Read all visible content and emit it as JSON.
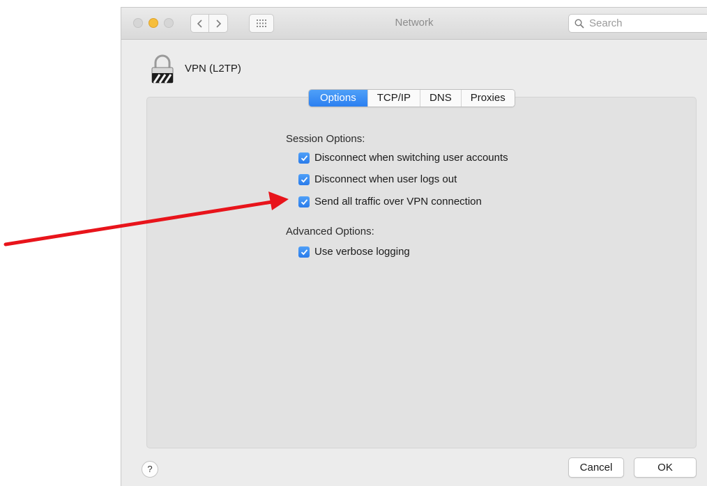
{
  "window": {
    "title": "Network",
    "search_placeholder": "Search"
  },
  "connection": {
    "name": "VPN (L2TP)",
    "icon": "vpn-lock-icon"
  },
  "tabs": [
    {
      "label": "Options",
      "active": true
    },
    {
      "label": "TCP/IP",
      "active": false
    },
    {
      "label": "DNS",
      "active": false
    },
    {
      "label": "Proxies",
      "active": false
    }
  ],
  "session_options": {
    "heading": "Session Options:",
    "items": [
      {
        "label": "Disconnect when switching user accounts",
        "checked": true
      },
      {
        "label": "Disconnect when user logs out",
        "checked": true
      },
      {
        "label": "Send all traffic over VPN connection",
        "checked": true
      }
    ]
  },
  "advanced_options": {
    "heading": "Advanced Options:",
    "items": [
      {
        "label": "Use verbose logging",
        "checked": true
      }
    ]
  },
  "buttons": {
    "help": "?",
    "cancel": "Cancel",
    "ok": "OK"
  },
  "colors": {
    "accent": "#2b7ff0",
    "annotation_arrow": "#e8141b",
    "traffic_minimize": "#f6be3b"
  }
}
